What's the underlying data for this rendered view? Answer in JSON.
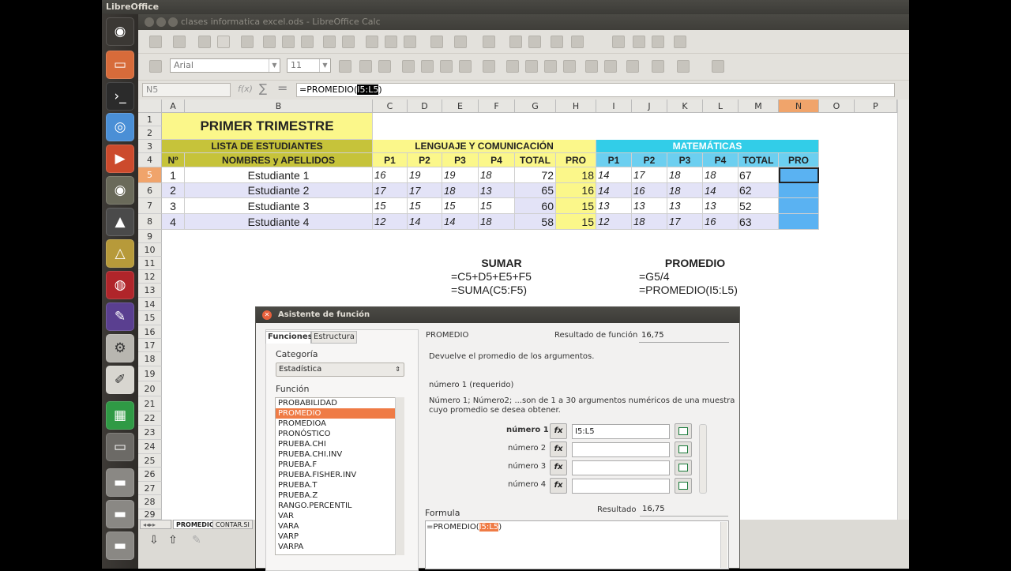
{
  "topbar": {
    "title": "LibreOffice"
  },
  "window": {
    "title": "clases informatica excel.ods - LibreOffice Calc"
  },
  "toolbar": {
    "font": "Arial",
    "size": "11"
  },
  "formula_bar": {
    "namebox": "N5",
    "fx": "f(x)",
    "sigma": "∑",
    "equals": "=",
    "formula_prefix": "=PROMEDIO(",
    "formula_selected": "I5:L5",
    "formula_suffix": ")"
  },
  "columns": [
    "A",
    "B",
    "C",
    "D",
    "E",
    "F",
    "G",
    "H",
    "I",
    "J",
    "K",
    "L",
    "M",
    "N",
    "O",
    "P"
  ],
  "rows": [
    "1",
    "2",
    "3",
    "4",
    "5",
    "6",
    "7",
    "8",
    "9",
    "10",
    "11",
    "12",
    "13",
    "14",
    "15",
    "16",
    "17",
    "18",
    "19",
    "20",
    "21",
    "22",
    "23",
    "24",
    "25",
    "26",
    "27",
    "28",
    "29"
  ],
  "sheet": {
    "title": "PRIMER TRIMESTRE",
    "list_header": "LISTA DE ESTUDIANTES",
    "lang_header": "LENGUAJE Y COMUNICACIÓN",
    "math_header": "MATEMÁTICAS",
    "col_no": "Nº",
    "col_names": "NOMBRES y APELLIDOS",
    "sub_headers": [
      "P1",
      "P2",
      "P3",
      "P4",
      "TOTAL",
      "PRO",
      "P1",
      "P2",
      "P3",
      "P4",
      "TOTAL",
      "PRO"
    ],
    "students": [
      {
        "n": "1",
        "name": "Estudiante 1",
        "lang": [
          "16",
          "19",
          "19",
          "18"
        ],
        "ltotal": "72",
        "lpro": "18",
        "math": [
          "14",
          "17",
          "18",
          "18"
        ],
        "mtotal": "67",
        "mpro": ""
      },
      {
        "n": "2",
        "name": "Estudiante 2",
        "lang": [
          "17",
          "17",
          "18",
          "13"
        ],
        "ltotal": "65",
        "lpro": "16",
        "math": [
          "14",
          "16",
          "18",
          "14"
        ],
        "mtotal": "62",
        "mpro": ""
      },
      {
        "n": "3",
        "name": "Estudiante 3",
        "lang": [
          "15",
          "15",
          "15",
          "15"
        ],
        "ltotal": "60",
        "lpro": "15",
        "math": [
          "13",
          "13",
          "13",
          "13"
        ],
        "mtotal": "52",
        "mpro": ""
      },
      {
        "n": "4",
        "name": "Estudiante 4",
        "lang": [
          "12",
          "14",
          "14",
          "18"
        ],
        "ltotal": "58",
        "lpro": "15",
        "math": [
          "12",
          "18",
          "17",
          "16"
        ],
        "mtotal": "63",
        "mpro": ""
      }
    ],
    "sumar_title": "SUMAR",
    "sumar_1": "=C5+D5+E5+F5",
    "sumar_2": "=SUMA(C5:F5)",
    "promedio_title": "PROMEDIO",
    "promedio_1": "=G5/4",
    "promedio_2": "=PROMEDIO(I5:L5)"
  },
  "tabs": [
    "PROMEDIO",
    "CONTAR.SI"
  ],
  "dialog": {
    "title": "Asistente de función",
    "tab_functions": "Funciones",
    "tab_structure": "Estructura",
    "category_label": "Categoría",
    "category_value": "Estadística",
    "function_label": "Función",
    "functions": [
      "PROBABILIDAD",
      "PROMEDIO",
      "PROMEDIOA",
      "PRONÓSTICO",
      "PRUEBA.CHI",
      "PRUEBA.CHI.INV",
      "PRUEBA.F",
      "PRUEBA.FISHER.INV",
      "PRUEBA.T",
      "PRUEBA.Z",
      "RANGO.PERCENTIL",
      "VAR",
      "VARA",
      "VARP",
      "VARPA"
    ],
    "selected_function": "PROMEDIO",
    "result_label": "Resultado de función",
    "result_value": "16,75",
    "description": "Devuelve el promedio de los argumentos.",
    "arg_header": "número 1 (requerido)",
    "arg_desc_1": "Número 1; Número2; ...son de 1 a 30 argumentos numéricos de una muestra",
    "arg_desc_2": "cuyo promedio se desea obtener.",
    "args": [
      {
        "label": "número 1",
        "value": "I5:L5"
      },
      {
        "label": "número 2",
        "value": ""
      },
      {
        "label": "número 3",
        "value": ""
      },
      {
        "label": "número 4",
        "value": ""
      }
    ],
    "formula_label": "Formula",
    "resultado_label": "Resultado",
    "resultado_value": "16,75",
    "formula_prefix": "=PROMEDIO(",
    "formula_selected": "I5:L5",
    "formula_suffix": ")",
    "fx_glyph": "fx"
  }
}
